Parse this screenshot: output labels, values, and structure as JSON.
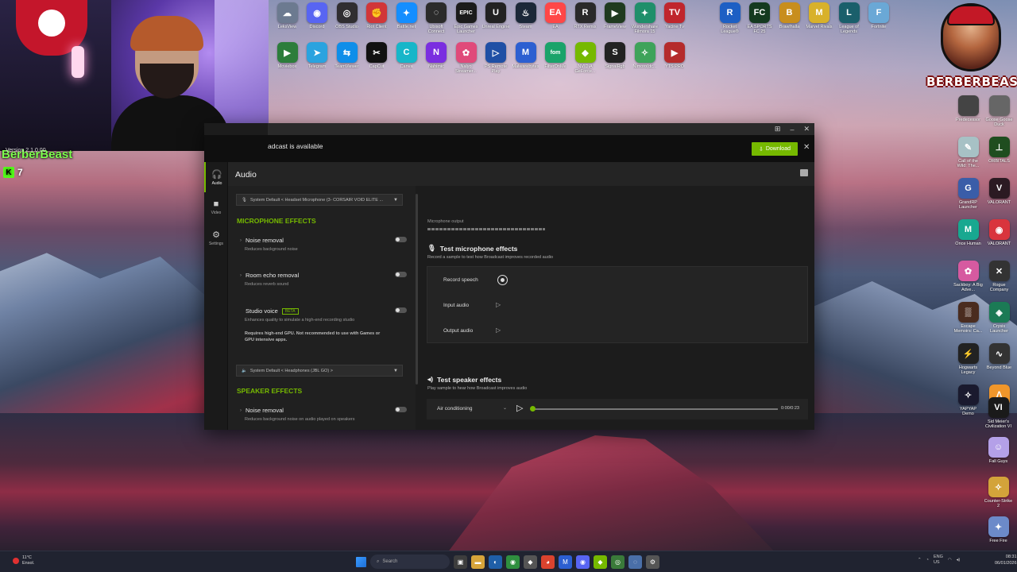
{
  "overlay": {
    "streamer_name": "BerberBeast",
    "viewer_count": "7",
    "viewer_badge": "K",
    "logo_text": "BERBERBEAST"
  },
  "desktop": {
    "top_row_1": [
      {
        "label": "LeksView",
        "icon": "cloud-icon",
        "color": "#6c7a90",
        "glyph": "☁"
      },
      {
        "label": "Discord",
        "icon": "discord-icon",
        "color": "#5865f2",
        "glyph": "◉"
      },
      {
        "label": "OBS Studio",
        "icon": "obs-icon",
        "color": "#302e31",
        "glyph": "◎"
      },
      {
        "label": "Riot Client",
        "icon": "riot-icon",
        "color": "#d13639",
        "glyph": "✊"
      },
      {
        "label": "Battle.net",
        "icon": "battlenet-icon",
        "color": "#148eff",
        "glyph": "✦"
      },
      {
        "label": "Ubisoft Connect",
        "icon": "ubisoft-icon",
        "color": "#2b2b2b",
        "glyph": "◌"
      },
      {
        "label": "Epic Games Launcher",
        "icon": "epic-icon",
        "color": "#1b1b1b",
        "glyph": "EPIC"
      },
      {
        "label": "Unreal Engine",
        "icon": "unreal-icon",
        "color": "#222",
        "glyph": "U"
      },
      {
        "label": "Steam",
        "icon": "steam-icon",
        "color": "#1b2838",
        "glyph": "♨"
      },
      {
        "label": "EA",
        "icon": "ea-icon",
        "color": "#ff4747",
        "glyph": "EA"
      },
      {
        "label": "RTX Remix",
        "icon": "rtx-remix-icon",
        "color": "#2a2a2a",
        "glyph": "R"
      },
      {
        "label": "FrameView",
        "icon": "frameview-icon",
        "color": "#1f3a1f",
        "glyph": "▶"
      },
      {
        "label": "Wondershare Filmora 15",
        "icon": "filmora-icon",
        "color": "#1f8f6a",
        "glyph": "✦"
      },
      {
        "label": "Yacine Tv",
        "icon": "yacine-icon",
        "color": "#c0262d",
        "glyph": "TV"
      }
    ],
    "top_row_2": [
      {
        "label": "Moviebox",
        "icon": "moviebox-icon",
        "color": "#2c7d3b",
        "glyph": "▶"
      },
      {
        "label": "Telegram",
        "icon": "telegram-icon",
        "color": "#2aa3df",
        "glyph": "➤"
      },
      {
        "label": "TeamViewer",
        "icon": "teamviewer-icon",
        "color": "#0e8ee9",
        "glyph": "⇆"
      },
      {
        "label": "CapCut",
        "icon": "capcut-icon",
        "color": "#111",
        "glyph": "✂"
      },
      {
        "label": "Canva",
        "icon": "canva-icon",
        "color": "#17b6c9",
        "glyph": "C"
      },
      {
        "label": "Nahimic",
        "icon": "nahimic-icon",
        "color": "#7a2ee0",
        "glyph": "N"
      },
      {
        "label": "Nalyo Streamer...",
        "icon": "nalyo-icon",
        "color": "#e04a7a",
        "glyph": "✿"
      },
      {
        "label": "PS Remote Play",
        "icon": "ps-remote-icon",
        "color": "#1f4fa5",
        "glyph": "▷"
      },
      {
        "label": "Malwarebytes",
        "icon": "malwarebytes-icon",
        "color": "#2c5fd1",
        "glyph": "M"
      },
      {
        "label": "FilterOnMe",
        "icon": "fom-icon",
        "color": "#1aa36a",
        "glyph": "fom"
      },
      {
        "label": "NVIDIA GeForce...",
        "icon": "nvidia-icon",
        "color": "#76b900",
        "glyph": "◆"
      },
      {
        "label": "SignalRgb",
        "icon": "signalrgb-icon",
        "color": "#222",
        "glyph": "S"
      },
      {
        "label": "Nimoro(dc...",
        "icon": "nimo-icon",
        "color": "#3ea35a",
        "glyph": "✧"
      },
      {
        "label": "YTS PRO",
        "icon": "yts-icon",
        "color": "#b52b2b",
        "glyph": "▶"
      }
    ],
    "right_top_row": [
      {
        "label": "Rocket League®",
        "icon": "rocket-league-icon",
        "color": "#1d5fc4",
        "glyph": "R"
      },
      {
        "label": "EA SPORTS FC 25",
        "icon": "easports-icon",
        "color": "#143a1f",
        "glyph": "FC"
      },
      {
        "label": "Brawlhalla",
        "icon": "brawlhalla-icon",
        "color": "#c88e1d",
        "glyph": "B"
      },
      {
        "label": "Marvel Rivals",
        "icon": "marvel-rivals-icon",
        "color": "#d8b12a",
        "glyph": "M"
      },
      {
        "label": "League of Legends",
        "icon": "lol-icon",
        "color": "#1a5f6b",
        "glyph": "L"
      },
      {
        "label": "Fortnite",
        "icon": "fortnite-icon",
        "color": "#6aa8d6",
        "glyph": "F"
      }
    ],
    "right_column": [
      {
        "label": "Predecessor",
        "icon": "predecessor-icon",
        "color": "#444",
        "glyph": ""
      },
      {
        "label": "Goose Goose Duck",
        "icon": "goose-icon",
        "color": "#666",
        "glyph": ""
      },
      {
        "label": "Call of the Wild: The...",
        "icon": "cotw-icon",
        "color": "#a7c1c5",
        "glyph": "✎"
      },
      {
        "label": "ORBITALS",
        "icon": "orbitals-icon",
        "color": "#1f4d1f",
        "glyph": "⊥"
      },
      {
        "label": "GrandRP Launcher",
        "icon": "grandrp-icon",
        "color": "#3a5da8",
        "glyph": "G"
      },
      {
        "label": "VALORANT",
        "icon": "valorant-icon",
        "color": "#2b1a22",
        "glyph": "V"
      },
      {
        "label": "Once Human",
        "icon": "once-human-icon",
        "color": "#18a890",
        "glyph": "M"
      },
      {
        "label": "VALORANT",
        "icon": "valorant-icon-2",
        "color": "#d9343d",
        "glyph": "◉"
      },
      {
        "label": "Sackboy: A Big Adve...",
        "icon": "sackboy-icon",
        "color": "#d65aa0",
        "glyph": "✿"
      },
      {
        "label": "Rogue Company",
        "icon": "rogue-company-icon",
        "color": "#333",
        "glyph": "✕"
      },
      {
        "label": "Escape Memoirs: Ca...",
        "icon": "escape-memoirs-icon",
        "color": "#4a2c1f",
        "glyph": "▒"
      },
      {
        "label": "Crysis Launcher",
        "icon": "crysis-icon",
        "color": "#1b7a55",
        "glyph": "◈"
      },
      {
        "label": "Hogwarts Legacy",
        "icon": "hogwarts-icon",
        "color": "#222",
        "glyph": "⚡"
      },
      {
        "label": "Beyond Blue",
        "icon": "beyond-blue-icon",
        "color": "#333",
        "glyph": "∿"
      },
      {
        "label": "YAPYAP Demo",
        "icon": "yapyap-icon",
        "color": "#1a1a2e",
        "glyph": "✧"
      },
      {
        "label": "FiveM",
        "icon": "fivem-icon",
        "color": "#f0962a",
        "glyph": "Λ"
      }
    ],
    "right_column_2": [
      {
        "label": "Sid Meier's Civilization VI",
        "icon": "civ6-icon",
        "color": "#1a1a1a",
        "glyph": "VI"
      },
      {
        "label": "Fall Guys",
        "icon": "fall-guys-icon",
        "color": "#b4a0e8",
        "glyph": "☺"
      },
      {
        "label": "Counter-Strike 2",
        "icon": "cs2-icon",
        "color": "#d3a33a",
        "glyph": "✧"
      },
      {
        "label": "Free Fire",
        "icon": "free-fire-icon",
        "color": "#6c8ac9",
        "glyph": "✦"
      }
    ]
  },
  "app": {
    "version": "Version 2.1.0.00",
    "banner_message": "adcast is available",
    "download_label": "Download",
    "page_title": "Audio",
    "nav": [
      {
        "label": "Audio",
        "icon": "headphones-icon",
        "glyph": "🎧",
        "active": true
      },
      {
        "label": "Video",
        "icon": "camera-icon",
        "glyph": "■",
        "active": false
      },
      {
        "label": "Settings",
        "icon": "gear-icon",
        "glyph": "⚙",
        "active": false
      }
    ],
    "mic_device": "System Default < Headset Microphone (3- CORSAIR VOID ELITE ...",
    "speaker_device": "System Default < Headphones (JBL GO) >",
    "mic_section_title": "MICROPHONE EFFECTS",
    "speaker_section_title": "SPEAKER EFFECTS",
    "mic_effects": [
      {
        "name": "Noise removal",
        "desc": "Reduces background noise",
        "enabled": false
      },
      {
        "name": "Room echo removal",
        "desc": "Reduces reverb sound",
        "enabled": false
      },
      {
        "name": "Studio voice",
        "badge": "BETA",
        "desc": "Enhances quality to simulate a high-end recording studio",
        "warning": "Requires high-end GPU. Not recommended to use with Games or GPU intensive apps.",
        "enabled": false
      }
    ],
    "speaker_effects": [
      {
        "name": "Noise removal",
        "desc": "Reduces background noise on audio played on speakers",
        "enabled": false
      }
    ],
    "mic_output_label": "Microphone output",
    "test_mic_title": "Test microphone effects",
    "test_mic_sub": "Record a sample to test how Broadcast improves recorded audio",
    "record_speech": "Record speech",
    "input_audio": "Input audio",
    "output_audio": "Output audio",
    "test_speaker_title": "Test speaker effects",
    "test_speaker_sub": "Play sample to hear how Broadcast improves audio",
    "sample_selected": "Air conditioning",
    "playback_time": "0:00/0:23",
    "playback_progress": 0,
    "accent_color": "#76b900"
  },
  "taskbar": {
    "weather_temp": "11°C",
    "weather_text": "Ensol.",
    "search_placeholder": "Search",
    "language": "ENG",
    "language_sub": "US",
    "time": "08:31",
    "date": "06/01/2026"
  }
}
